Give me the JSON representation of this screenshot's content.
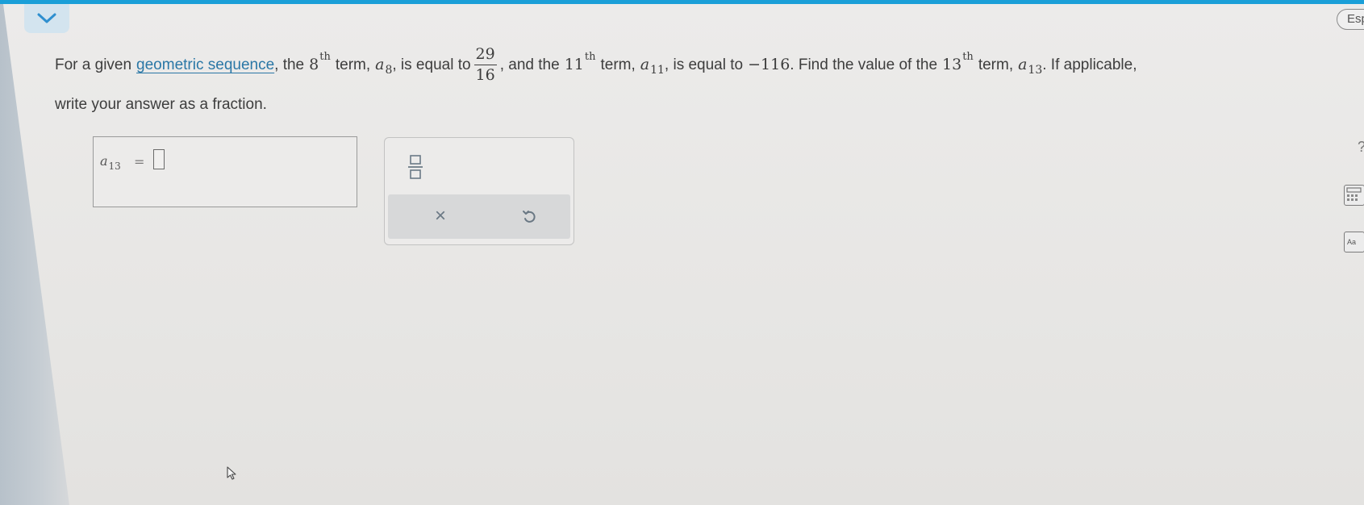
{
  "question": {
    "part1": "For a given",
    "link_text": "geometric sequence",
    "part2": ", the",
    "n1": "8",
    "th1": "th",
    "part3": "term,",
    "var_a": "a",
    "sub1": "8",
    "part4": ", is equal to",
    "frac_num": "29",
    "frac_den": "16",
    "part5": ", and the",
    "n2": "11",
    "th2": "th",
    "part6": "term,",
    "sub2": "11",
    "part7": ", is equal to",
    "value2": "−116",
    "part8": ". Find the value of the",
    "n3": "13",
    "th3": "th",
    "part9": "term,",
    "sub3": "13",
    "part10": ". If applicable,",
    "line2": "write your answer as a fraction."
  },
  "answer": {
    "label_var": "a",
    "label_sub": "13",
    "equals": "=",
    "value": ""
  },
  "tools": {
    "fraction_icon": "fraction-template-icon",
    "clear_icon": "close-icon",
    "clear_glyph": "×",
    "undo_icon": "undo-icon"
  },
  "sidebar": {
    "lang_label": "Esp",
    "help_glyph": "?",
    "calculator_icon": "calculator-icon",
    "reference_icon": "reference-icon",
    "reference_label": "Aa"
  },
  "colors": {
    "accent": "#1a9fd8",
    "link": "#2a77a6",
    "collapse_bg": "#d3e4ef"
  }
}
